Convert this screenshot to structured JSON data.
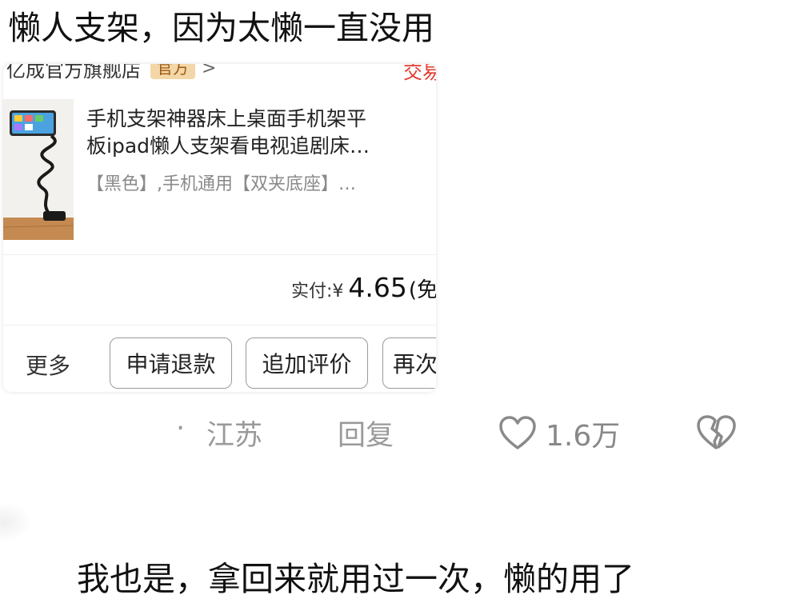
{
  "comment": {
    "text": "懒人支架，因为太懒一直没用"
  },
  "order_card": {
    "shop_name": "亿成官方旗舰店",
    "shop_badge": "官方",
    "shop_chevron": ">",
    "status": "交易",
    "product_title_line1": "手机支架神器床上桌面手机架平",
    "product_title_line2": "板ipad懒人支架看电视追剧床…",
    "product_spec": "【黑色】,手机通用【双夹底座】…",
    "paid_label": "实付:",
    "paid_currency": "¥",
    "paid_amount": "4.65",
    "paid_suffix": "(免",
    "more_label": "更多",
    "buttons": {
      "refund": "申请退款",
      "review": "追加评价",
      "rebuy": "再次"
    }
  },
  "comment_meta": {
    "dot": "·",
    "location": "江苏",
    "reply": "回复",
    "like_count": "1.6万",
    "like_icon": "heart-outline-icon",
    "dislike_icon": "broken-heart-icon"
  },
  "reply_comment": {
    "text": "我也是，拿回来就用过一次，懒的用了"
  },
  "colors": {
    "badge_bg": "#f4d7a8",
    "badge_text": "#9c5a10",
    "status_red": "#e23a2d",
    "meta_gray": "#9a9a9a"
  }
}
